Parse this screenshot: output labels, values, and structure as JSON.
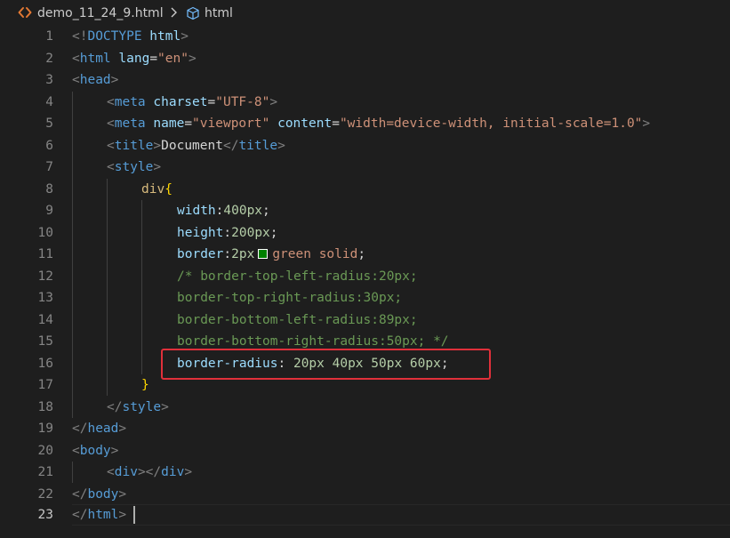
{
  "breadcrumb": {
    "file_name": "demo_11_24_9.html",
    "symbol": "html"
  },
  "colors": {
    "editor_background": "#1e1e1e",
    "highlight_border": "#e0303a",
    "swatch_green": "#008000"
  },
  "line_numbers": [
    "1",
    "2",
    "3",
    "4",
    "5",
    "6",
    "7",
    "8",
    "9",
    "10",
    "11",
    "12",
    "13",
    "14",
    "15",
    "16",
    "17",
    "18",
    "19",
    "20",
    "21",
    "22",
    "23"
  ],
  "active_line": "23",
  "code": {
    "l1": {
      "t1": "<!",
      "t2": "DOCTYPE",
      "t3": " html",
      "t4": ">"
    },
    "l2": {
      "t1": "<",
      "t2": "html",
      "t3": " lang",
      "t4": "=",
      "t5": "\"en\"",
      "t6": ">"
    },
    "l3": {
      "t1": "<",
      "t2": "head",
      "t3": ">"
    },
    "l4": {
      "t1": "<",
      "t2": "meta",
      "t3": " charset",
      "t4": "=",
      "t5": "\"UTF-8\"",
      "t6": ">"
    },
    "l5": {
      "t1": "<",
      "t2": "meta",
      "t3": " name",
      "t4": "=",
      "t5": "\"viewport\"",
      "t6": " content",
      "t7": "=",
      "t8": "\"width=device-width, initial-scale=1.0\"",
      "t9": ">"
    },
    "l6": {
      "t1": "<",
      "t2": "title",
      "t3": ">",
      "t4": "Document",
      "t5": "</",
      "t6": "title",
      "t7": ">"
    },
    "l7": {
      "t1": "<",
      "t2": "style",
      "t3": ">"
    },
    "l8": {
      "t1": "div",
      "t2": "{"
    },
    "l9": {
      "t1": "width",
      "t2": ":",
      "t3": "400px",
      "t4": ";"
    },
    "l10": {
      "t1": "height",
      "t2": ":",
      "t3": "200px",
      "t4": ";"
    },
    "l11": {
      "t1": "border",
      "t2": ":",
      "t3": "2px",
      "t4": "green solid",
      "t5": ";"
    },
    "l12": {
      "t1": "/* border-top-left-radius:20px;"
    },
    "l13": {
      "t1": "border-top-right-radius:30px;"
    },
    "l14": {
      "t1": "border-bottom-left-radius:89px;"
    },
    "l15": {
      "t1": "border-bottom-right-radius:50px; */"
    },
    "l16": {
      "t1": "border-radius",
      "t2": ": ",
      "t3": "20px 40px 50px 60px",
      "t4": ";"
    },
    "l17": {
      "t1": "}"
    },
    "l18": {
      "t1": "</",
      "t2": "style",
      "t3": ">"
    },
    "l19": {
      "t1": "</",
      "t2": "head",
      "t3": ">"
    },
    "l20": {
      "t1": "<",
      "t2": "body",
      "t3": ">"
    },
    "l21": {
      "t1": "<",
      "t2": "div",
      "t3": "></",
      "t4": "div",
      "t5": ">"
    },
    "l22": {
      "t1": "</",
      "t2": "body",
      "t3": ">"
    },
    "l23": {
      "t1": "</",
      "t2": "html",
      "t3": ">"
    }
  }
}
